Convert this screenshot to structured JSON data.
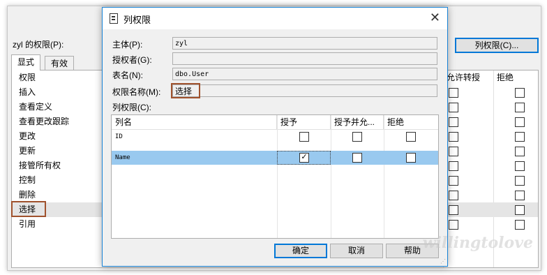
{
  "background_window": {
    "perm_label": "zyl 的权限(P):",
    "column_permissions_button": "列权限(C)...",
    "tabs": [
      {
        "label": "显式"
      },
      {
        "label": "有效"
      }
    ],
    "grid_header": {
      "col0": "权限",
      "col_grant_with": "允许转授",
      "col_deny": "拒绝"
    },
    "permissions": [
      {
        "label": "插入"
      },
      {
        "label": "查看定义"
      },
      {
        "label": "查看更改跟踪"
      },
      {
        "label": "更改"
      },
      {
        "label": "更新"
      },
      {
        "label": "接管所有权"
      },
      {
        "label": "控制"
      },
      {
        "label": "删除"
      },
      {
        "label": "选择"
      },
      {
        "label": "引用"
      }
    ]
  },
  "dialog": {
    "title": "列权限",
    "principal_label": "主体(P):",
    "principal_value": "zyl",
    "grantor_label": "授权者(G):",
    "grantor_value": "",
    "table_name_label": "表名(N):",
    "table_name_value": "dbo.User",
    "perm_name_label": "权限名称(M):",
    "perm_name_value": "选择",
    "column_perms_label": "列权限(C):",
    "grid_headers": {
      "column_name": "列名",
      "grant": "授予",
      "grant_with": "授予并允...",
      "deny": "拒绝"
    },
    "rows": [
      {
        "name": "ID",
        "grant": false,
        "grant_with": false,
        "deny": false
      },
      {
        "name": "Name",
        "grant": true,
        "grant_with": false,
        "deny": false
      }
    ],
    "buttons": {
      "ok": "确定",
      "cancel": "取消",
      "help": "帮助"
    }
  },
  "watermark": "willingtolove",
  "colors": {
    "selection": "#99c9ef",
    "highlight_box": "#a0522d",
    "accent": "#0078d7"
  }
}
